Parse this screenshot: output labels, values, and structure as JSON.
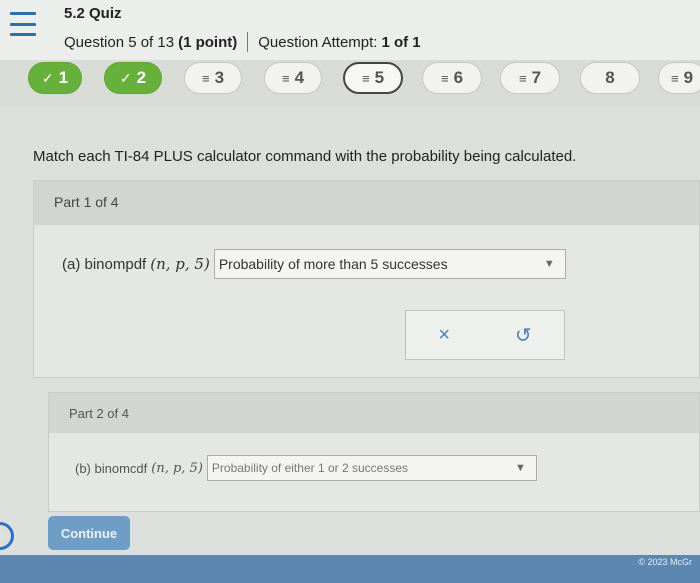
{
  "header": {
    "quiz_title": "5.2 Quiz",
    "question_label": "Question 5 of 13",
    "points": "(1 point)",
    "attempt_label": "Question Attempt:",
    "attempt_value": "1 of 1"
  },
  "nav": {
    "questions": [
      {
        "number": "1",
        "mark": "✓",
        "status": "done"
      },
      {
        "number": "2",
        "mark": "✓",
        "status": "done"
      },
      {
        "number": "3",
        "mark": "≡",
        "status": "pending"
      },
      {
        "number": "4",
        "mark": "≡",
        "status": "pending"
      },
      {
        "number": "5",
        "mark": "≡",
        "status": "current"
      },
      {
        "number": "6",
        "mark": "≡",
        "status": "pending"
      },
      {
        "number": "7",
        "mark": "≡",
        "status": "pending"
      },
      {
        "number": "8",
        "mark": "",
        "status": "pending"
      },
      {
        "number": "9",
        "mark": "≡",
        "status": "pending"
      }
    ]
  },
  "main": {
    "instructions": "Match each TI-84 PLUS calculator command with the probability being calculated.",
    "part1": {
      "header": "Part 1 of 4",
      "command": "(a) binompdf",
      "args": "(n, p, 5)",
      "selected": "Probability of more than 5 successes",
      "clear_icon": "×",
      "undo_icon": "↺"
    },
    "part2": {
      "header": "Part 2 of 4",
      "command": "(b) binomcdf",
      "args": "(n, p, 5)",
      "selected": "Probability of either 1 or 2 successes"
    },
    "continue_label": "Continue"
  },
  "footer": {
    "copyright": "© 2023 McGr"
  },
  "colors": {
    "done_green": "#67b03c",
    "accent_blue": "#5b87b0"
  }
}
